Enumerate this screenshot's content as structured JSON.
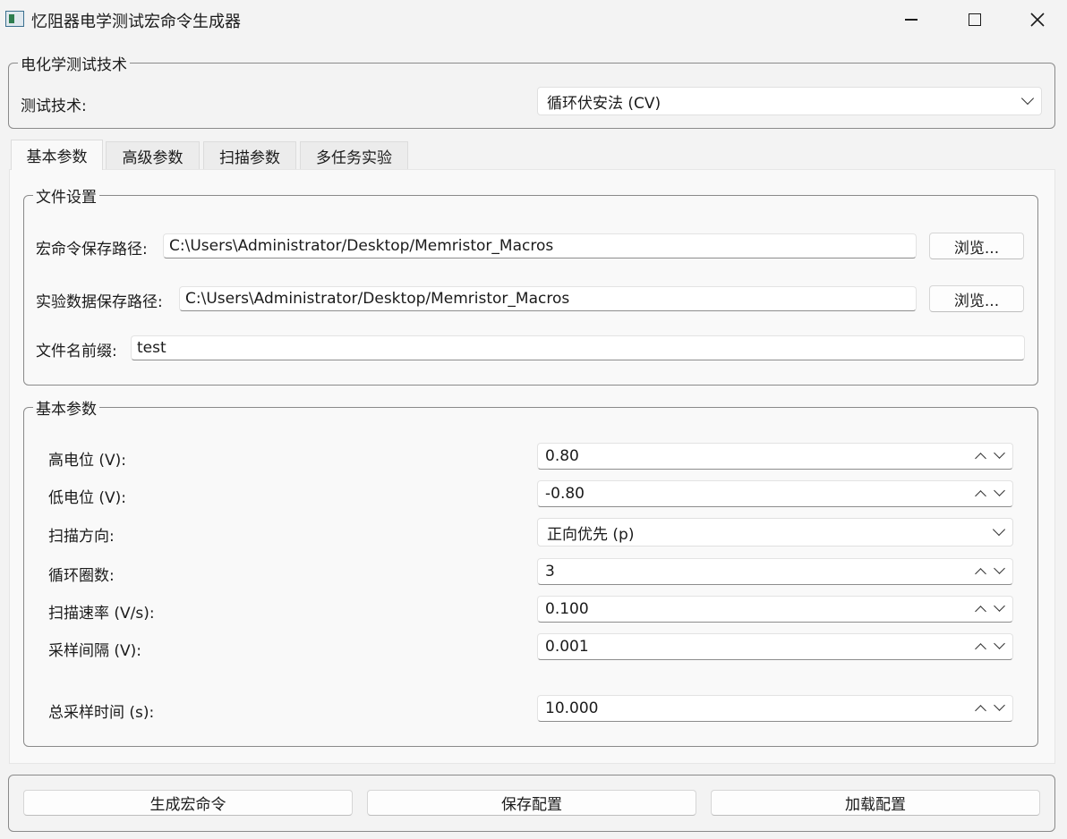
{
  "window": {
    "title": "忆阻器电学测试宏命令生成器"
  },
  "technique_group": {
    "title": "电化学测试技术",
    "label": "测试技术:",
    "selected": "循环伏安法 (CV)"
  },
  "tabs": [
    {
      "label": "基本参数",
      "active": true
    },
    {
      "label": "高级参数",
      "active": false
    },
    {
      "label": "扫描参数",
      "active": false
    },
    {
      "label": "多任务实验",
      "active": false
    }
  ],
  "file_settings": {
    "title": "文件设置",
    "macro_path_label": "宏命令保存路径:",
    "macro_path_value": "C:\\Users\\Administrator/Desktop/Memristor_Macros",
    "data_path_label": "实验数据保存路径:",
    "data_path_value": "C:\\Users\\Administrator/Desktop/Memristor_Macros",
    "browse_label": "浏览...",
    "prefix_label": "文件名前缀:",
    "prefix_value": "test"
  },
  "basic_params": {
    "title": "基本参数",
    "high_potential": {
      "label": "高电位 (V):",
      "value": "0.80"
    },
    "low_potential": {
      "label": "低电位 (V):",
      "value": "-0.80"
    },
    "scan_direction": {
      "label": "扫描方向:",
      "value": "正向优先 (p)"
    },
    "cycles": {
      "label": "循环圈数:",
      "value": "3"
    },
    "scan_rate": {
      "label": "扫描速率 (V/s):",
      "value": "0.100"
    },
    "sample_interval": {
      "label": "采样间隔 (V):",
      "value": "0.001"
    },
    "total_time": {
      "label": "总采样时间 (s):",
      "value": "10.000"
    }
  },
  "actions": {
    "generate": "生成宏命令",
    "save": "保存配置",
    "load": "加载配置"
  }
}
